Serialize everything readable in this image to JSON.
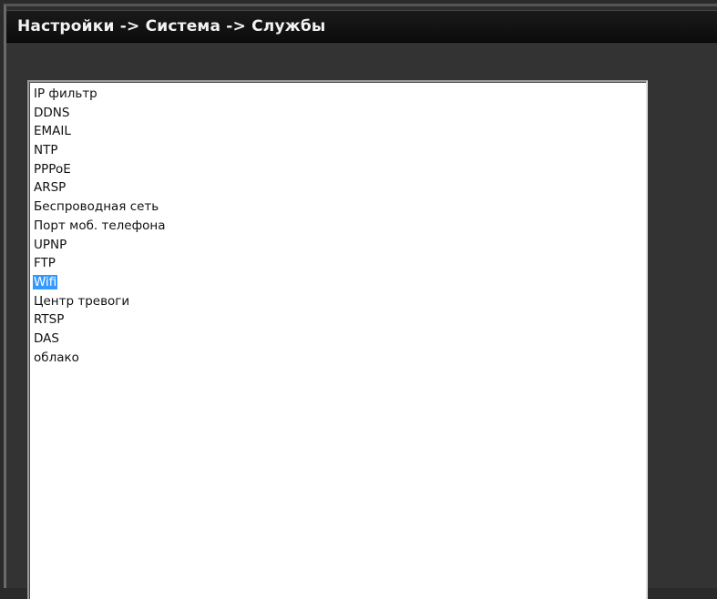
{
  "breadcrumb": {
    "text": "Настройки -> Система -> Службы"
  },
  "services": {
    "items": [
      {
        "label": "IP фильтр",
        "selected": false
      },
      {
        "label": "DDNS",
        "selected": false
      },
      {
        "label": "EMAIL",
        "selected": false
      },
      {
        "label": "NTP",
        "selected": false
      },
      {
        "label": "PPPoE",
        "selected": false
      },
      {
        "label": "ARSP",
        "selected": false
      },
      {
        "label": "Беспроводная сеть",
        "selected": false
      },
      {
        "label": "Порт моб. телефона",
        "selected": false
      },
      {
        "label": "UPNP",
        "selected": false
      },
      {
        "label": "FTP",
        "selected": false
      },
      {
        "label": "Wifi",
        "selected": true
      },
      {
        "label": "Центр тревоги",
        "selected": false
      },
      {
        "label": "RTSP",
        "selected": false
      },
      {
        "label": "DAS",
        "selected": false
      },
      {
        "label": "облако",
        "selected": false
      }
    ]
  },
  "colors": {
    "selection": "#3399ff",
    "background": "#333333",
    "title_bar": "#111111"
  }
}
